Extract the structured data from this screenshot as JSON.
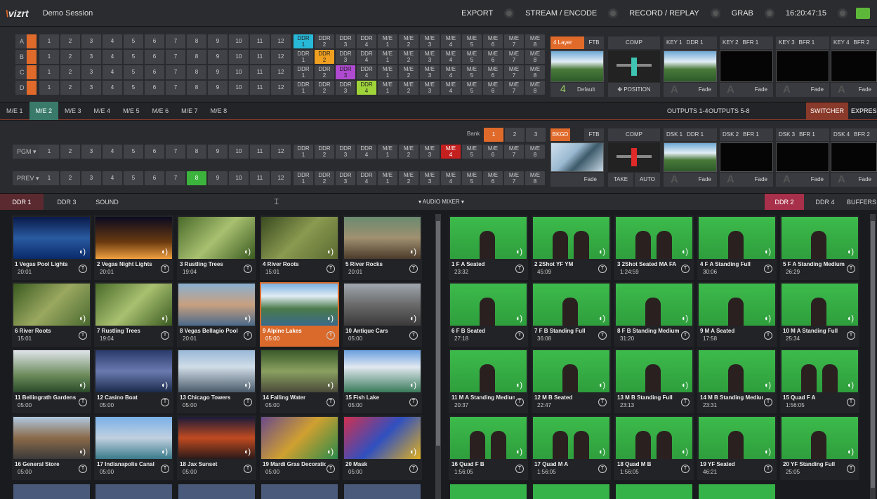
{
  "app": {
    "logo": "vizrt",
    "session": "Demo Session"
  },
  "topnav": [
    {
      "label": "EXPORT"
    },
    {
      "label": "STREAM / ENCODE"
    },
    {
      "label": "RECORD / REPLAY"
    },
    {
      "label": "GRAB"
    },
    {
      "label": "16:20:47:15"
    }
  ],
  "rows": {
    "labels": [
      "A",
      "B",
      "C",
      "D"
    ],
    "numbers": [
      "1",
      "2",
      "3",
      "4",
      "5",
      "6",
      "7",
      "8",
      "9",
      "10",
      "11",
      "12"
    ],
    "ddr": [
      [
        "DDR",
        "1"
      ],
      [
        "DDR",
        "2"
      ],
      [
        "DDR",
        "3"
      ],
      [
        "DDR",
        "4"
      ]
    ],
    "me": [
      [
        "M/E",
        "1"
      ],
      [
        "M/E",
        "2"
      ],
      [
        "M/E",
        "3"
      ],
      [
        "M/E",
        "4"
      ],
      [
        "M/E",
        "5"
      ],
      [
        "M/E",
        "6"
      ],
      [
        "M/E",
        "7"
      ],
      [
        "M/E",
        "8"
      ]
    ]
  },
  "layer": {
    "label": "4 Layer",
    "ftb": "FTB",
    "count": "4",
    "default": "Default"
  },
  "comp": {
    "label": "COMP",
    "position": "POSITION",
    "take": "TAKE",
    "auto": "AUTO"
  },
  "keys": [
    {
      "key": "KEY 1",
      "src": "DDR 1",
      "fade": "Fade"
    },
    {
      "key": "KEY 2",
      "src": "BFR 1",
      "fade": "Fade"
    },
    {
      "key": "KEY 3",
      "src": "BFR 1",
      "fade": "Fade"
    },
    {
      "key": "KEY 4",
      "src": "BFR 2",
      "fade": "Fade"
    }
  ],
  "tabs": [
    "M/E 1",
    "M/E 2",
    "M/E 3",
    "M/E 4",
    "M/E 5",
    "M/E 6",
    "M/E 7",
    "M/E 8"
  ],
  "outputs": {
    "o1": "OUTPUTS 1-4",
    "o2": "OUTPUTS 5-8",
    "switcher": "SWITCHER",
    "express": "EXPRESS"
  },
  "switcher": {
    "bank": "Bank",
    "banks": [
      "1",
      "2",
      "3"
    ],
    "pgm": "PGM",
    "prev": "PREV",
    "bkgd": "BKGD",
    "ftb": "FTB",
    "fade": "Fade",
    "dsk": [
      {
        "key": "DSK 1",
        "src": "DDR 1"
      },
      {
        "key": "DSK 2",
        "src": "BFR 1"
      },
      {
        "key": "DSK 3",
        "src": "BFR 1"
      },
      {
        "key": "DSK 4",
        "src": "BFR 2"
      }
    ]
  },
  "ddrbar": {
    "left": [
      "DDR 1",
      "DDR 3",
      "SOUND"
    ],
    "audio": "AUDIO MIXER",
    "right": [
      "DDR 2",
      "DDR 4",
      "BUFFERS"
    ]
  },
  "left_clips": [
    {
      "title": "1 Vegas Pool Lights",
      "dur": "20:01"
    },
    {
      "title": "2 Vegas Night Lights",
      "dur": "20:01"
    },
    {
      "title": "3 Rustling Trees",
      "dur": "19:04"
    },
    {
      "title": "4 River Roots",
      "dur": "15:01"
    },
    {
      "title": "5 River Rocks",
      "dur": "20:01"
    },
    {
      "title": "6 River Roots",
      "dur": "15:01"
    },
    {
      "title": "7 Rustling Trees",
      "dur": "19:04"
    },
    {
      "title": "8 Vegas Bellagio Pool",
      "dur": "20:01"
    },
    {
      "title": "9 Alpine Lakes",
      "dur": "05:00"
    },
    {
      "title": "10 Antique Cars",
      "dur": "05:00"
    },
    {
      "title": "11 Bellingrath Gardens",
      "dur": "05:00"
    },
    {
      "title": "12 Casino Boat",
      "dur": "05:00"
    },
    {
      "title": "13 Chicago Towers",
      "dur": "05:00"
    },
    {
      "title": "14 Falling Water",
      "dur": "05:00"
    },
    {
      "title": "15 Fish Lake",
      "dur": "05:00"
    },
    {
      "title": "16 General Store",
      "dur": "05:00"
    },
    {
      "title": "17 Indianapolis Canal",
      "dur": "05:00"
    },
    {
      "title": "18 Jax Sunset",
      "dur": "05:00"
    },
    {
      "title": "19 Mardi Gras Decoration",
      "dur": "05:00"
    },
    {
      "title": "20 Mask",
      "dur": "05:00"
    }
  ],
  "right_clips": [
    {
      "title": "1 F A Seated",
      "dur": "23:32"
    },
    {
      "title": "2 2Shot YF YM",
      "dur": "45:09"
    },
    {
      "title": "3 2Shot Seated MA FA",
      "dur": "1:24:59"
    },
    {
      "title": "4 F A Standing Full",
      "dur": "30:06"
    },
    {
      "title": "5 F A Standing Medium",
      "dur": "26:29"
    },
    {
      "title": "6 F B Seated",
      "dur": "27:18"
    },
    {
      "title": "7 F B Standing Full",
      "dur": "36:08"
    },
    {
      "title": "8 F B Standing Medium",
      "dur": "31:20"
    },
    {
      "title": "9 M A Seated",
      "dur": "17:58"
    },
    {
      "title": "10 M A Standing Full",
      "dur": "25:34"
    },
    {
      "title": "11 M A Standing Medium",
      "dur": "20:37"
    },
    {
      "title": "12 M B Seated",
      "dur": "22:47"
    },
    {
      "title": "13 M B Standing Full",
      "dur": "23:13"
    },
    {
      "title": "14 M B Standing Medium",
      "dur": "23:31"
    },
    {
      "title": "15 Quad F A",
      "dur": "1:56:05"
    },
    {
      "title": "16 Quad F B",
      "dur": "1:56:05"
    },
    {
      "title": "17 Quad M A",
      "dur": "1:56:05"
    },
    {
      "title": "18 Quad M B",
      "dur": "1:56:05"
    },
    {
      "title": "19 YF Seated",
      "dur": "46:21"
    },
    {
      "title": "20 YF Standing Full",
      "dur": "25:05"
    }
  ],
  "t_badge": "T",
  "colors": {
    "accent": "#e06a2a",
    "green": "#39b54a",
    "cyan": "#28b8d8",
    "purple": "#b04ad0",
    "red": "#c42020"
  }
}
